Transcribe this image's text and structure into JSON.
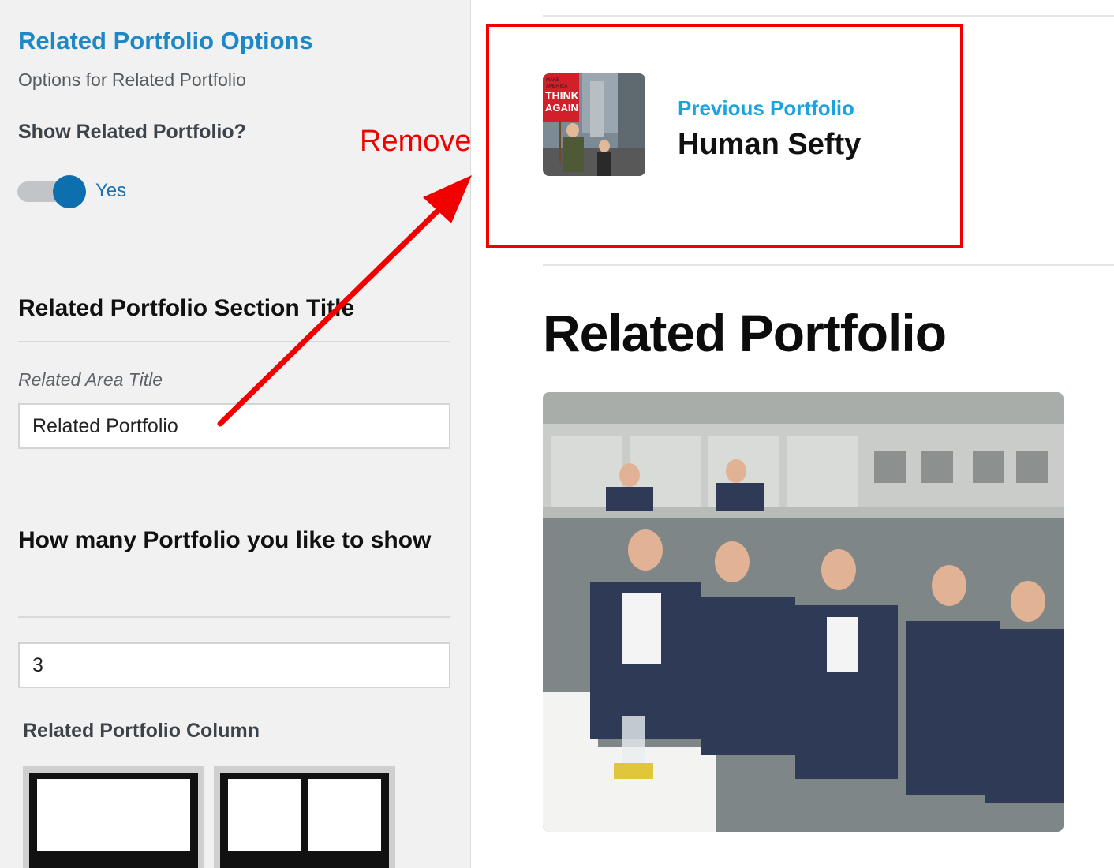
{
  "options_panel": {
    "title": "Related Portfolio Options",
    "description": "Options for Related Portfolio",
    "show_related_label": "Show Related Portfolio?",
    "show_related_toggle": {
      "state": "on",
      "label": "Yes"
    },
    "section_title_heading": "Related Portfolio Section Title",
    "area_title_label": "Related Area Title",
    "area_title_value": "Related Portfolio",
    "count_heading": "How many Portfolio you like to show",
    "count_value": "3",
    "column_label": "Related Portfolio Column",
    "column_options": [
      "1 column",
      "2 columns"
    ]
  },
  "preview": {
    "previous_label": "Previous Portfolio",
    "previous_title": "Human Sefty",
    "related_heading": "Related Portfolio",
    "thumbnail_sign_text": [
      "MAKE",
      "AMERICA",
      "THINK",
      "AGAIN"
    ]
  },
  "annotation": {
    "text": "Remove",
    "color": "#f20000"
  },
  "colors": {
    "accent_blue": "#1d88c7",
    "toggle_blue": "#0d6fad",
    "link_blue": "#1aa3dc",
    "panel_bg": "#f1f1f1"
  }
}
